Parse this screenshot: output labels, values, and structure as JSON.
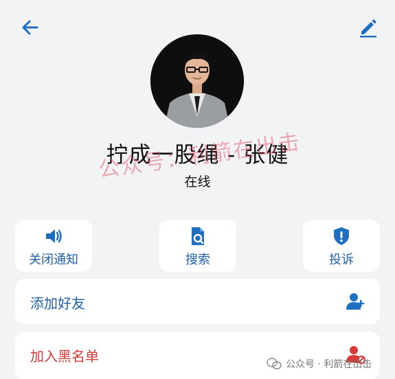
{
  "profile": {
    "name": "拧成一股绳 - 张健",
    "status": "在线"
  },
  "actions": [
    {
      "label": "关闭通知",
      "icon": "speaker-icon"
    },
    {
      "label": "搜索",
      "icon": "search-document-icon"
    },
    {
      "label": "投诉",
      "icon": "shield-alert-icon"
    }
  ],
  "rows": {
    "add_friend": {
      "label": "添加好友",
      "icon": "add-user-icon"
    },
    "blacklist": {
      "label": "加入黑名单",
      "icon": "block-user-icon"
    }
  },
  "watermark": {
    "overlay_text": "公众号：利箭在出击",
    "footer_text": "公众号 · 利箭在出击"
  },
  "colors": {
    "accent_blue": "#1e5fa8",
    "danger_red": "#d83a3a",
    "background": "#f2f3f5"
  }
}
